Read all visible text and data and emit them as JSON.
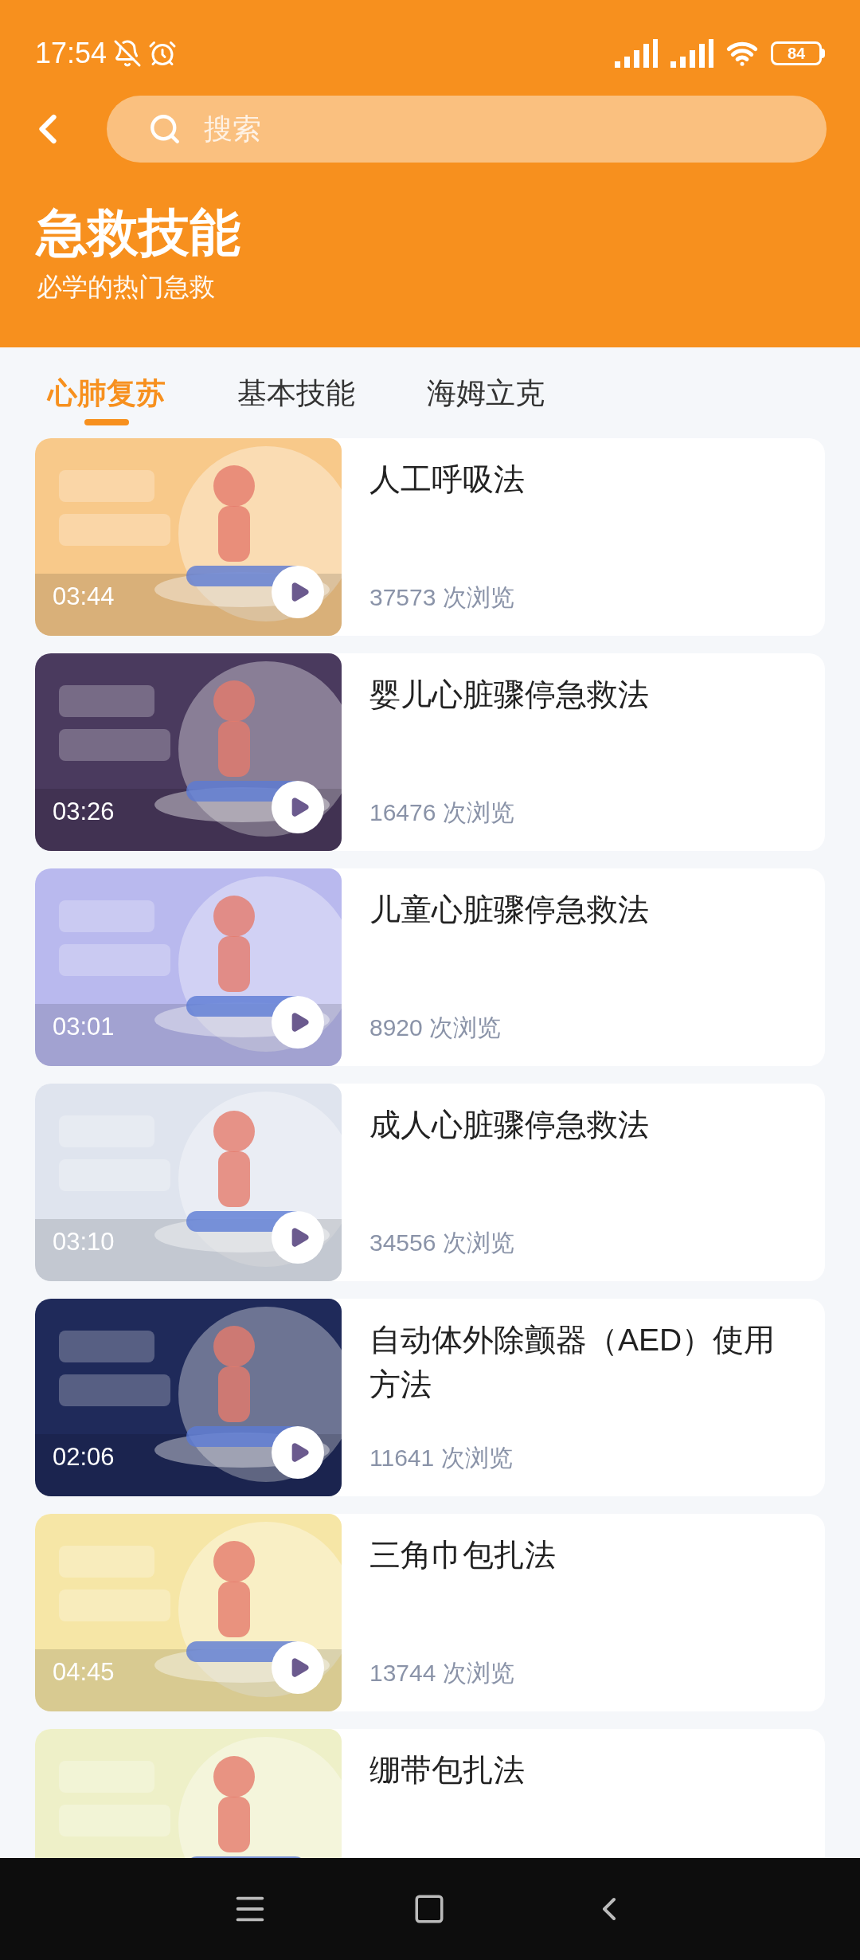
{
  "status_bar": {
    "time": "17:54",
    "battery": "84"
  },
  "search": {
    "placeholder": "搜索"
  },
  "header": {
    "title": "急救技能",
    "subtitle": "必学的热门急救"
  },
  "tabs": [
    {
      "label": "心肺复苏",
      "selected": true
    },
    {
      "label": "基本技能",
      "selected": false
    },
    {
      "label": "海姆立克",
      "selected": false
    }
  ],
  "videos": [
    {
      "title": "人工呼吸法",
      "duration": "03:44",
      "views": "37573 次浏览"
    },
    {
      "title": "婴儿心脏骤停急救法",
      "duration": "03:26",
      "views": "16476 次浏览"
    },
    {
      "title": "儿童心脏骤停急救法",
      "duration": "03:01",
      "views": "8920 次浏览"
    },
    {
      "title": "成人心脏骤停急救法",
      "duration": "03:10",
      "views": "34556 次浏览"
    },
    {
      "title": "自动体外除颤器（AED）使用方法",
      "duration": "02:06",
      "views": "11641 次浏览"
    },
    {
      "title": "三角巾包扎法",
      "duration": "04:45",
      "views": "13744 次浏览"
    },
    {
      "title": "绷带包扎法"
    }
  ]
}
